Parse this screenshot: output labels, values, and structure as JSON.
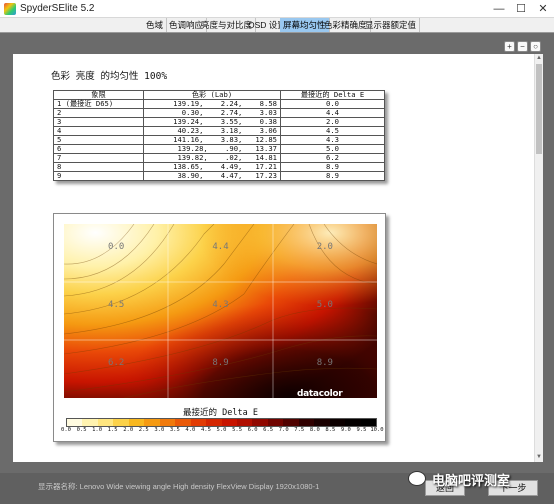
{
  "window": {
    "title": "SpyderSElite 5.2",
    "minimize": "—",
    "maximize": "☐",
    "close": "✕"
  },
  "tabs": [
    {
      "label": "色域"
    },
    {
      "label": "色调响应"
    },
    {
      "label": "亮度与对比度"
    },
    {
      "label": "OSD 设置"
    },
    {
      "label": "屏幕均匀性",
      "active": true
    },
    {
      "label": "色彩精确度"
    },
    {
      "label": "显示器额定值"
    }
  ],
  "toolbar": {
    "zoom_in": "+",
    "zoom_out": "−",
    "zoom_fit": "○"
  },
  "report": {
    "title": "色彩 亮度 的均匀性 100%",
    "table": {
      "headers": [
        "象限",
        "色彩 (Lab)",
        "最接近的 Delta E"
      ],
      "rows": [
        [
          "1 (最接近 D65)",
          "139.19,    2.24,    8.58",
          "0.0"
        ],
        [
          "2",
          "0.30,    2.74,    3.03",
          "4.4"
        ],
        [
          "3",
          "139.24,    3.55,    0.38",
          "2.0"
        ],
        [
          "4",
          "40.23,    3.18,    3.06",
          "4.5"
        ],
        [
          "5",
          "141.16,    3.83,   12.85",
          "4.3"
        ],
        [
          "6",
          "139.28,    .90,   13.37",
          "5.0"
        ],
        [
          "7",
          "139.82,    .02,   14.81",
          "6.2"
        ],
        [
          "8",
          "138.65,    4.49,   17.21",
          "8.9"
        ],
        [
          "9",
          "38.90,    4.47,   17.23",
          "8.9"
        ]
      ]
    }
  },
  "chart_data": {
    "type": "heatmap",
    "title": "",
    "grid": {
      "rows": 3,
      "cols": 3
    },
    "values": [
      [
        0.0,
        4.4,
        2.0
      ],
      [
        4.5,
        4.3,
        5.0
      ],
      [
        6.2,
        8.9,
        8.9
      ]
    ],
    "labels": [
      [
        "0.0",
        "4.4",
        "2.0"
      ],
      [
        "4.5",
        "4.3",
        "5.0"
      ],
      [
        "6.2",
        "8.9",
        "8.9"
      ]
    ],
    "scale_title": "最接近的 Delta E",
    "scale_ticks": [
      "0.0",
      "0.5",
      "1.0",
      "1.5",
      "2.0",
      "2.5",
      "3.0",
      "3.5",
      "4.0",
      "4.5",
      "5.0",
      "5.5",
      "6.0",
      "6.5",
      "7.0",
      "7.5",
      "8.0",
      "8.5",
      "9.0",
      "9.5",
      "10.0"
    ],
    "scale_range": [
      0,
      10
    ],
    "brand": "datacolor",
    "colors": {
      "low": "#ffffff",
      "mid": "#f4a300",
      "high": "#e01a00",
      "max": "#000000"
    }
  },
  "status": {
    "monitor": "显示器名称: Lenovo Wide viewing angle  High density FlexView Display 1920x1080-1"
  },
  "nav": {
    "back": "返回",
    "next": "下一步"
  },
  "watermark": {
    "text": "电脑吧评测室"
  }
}
